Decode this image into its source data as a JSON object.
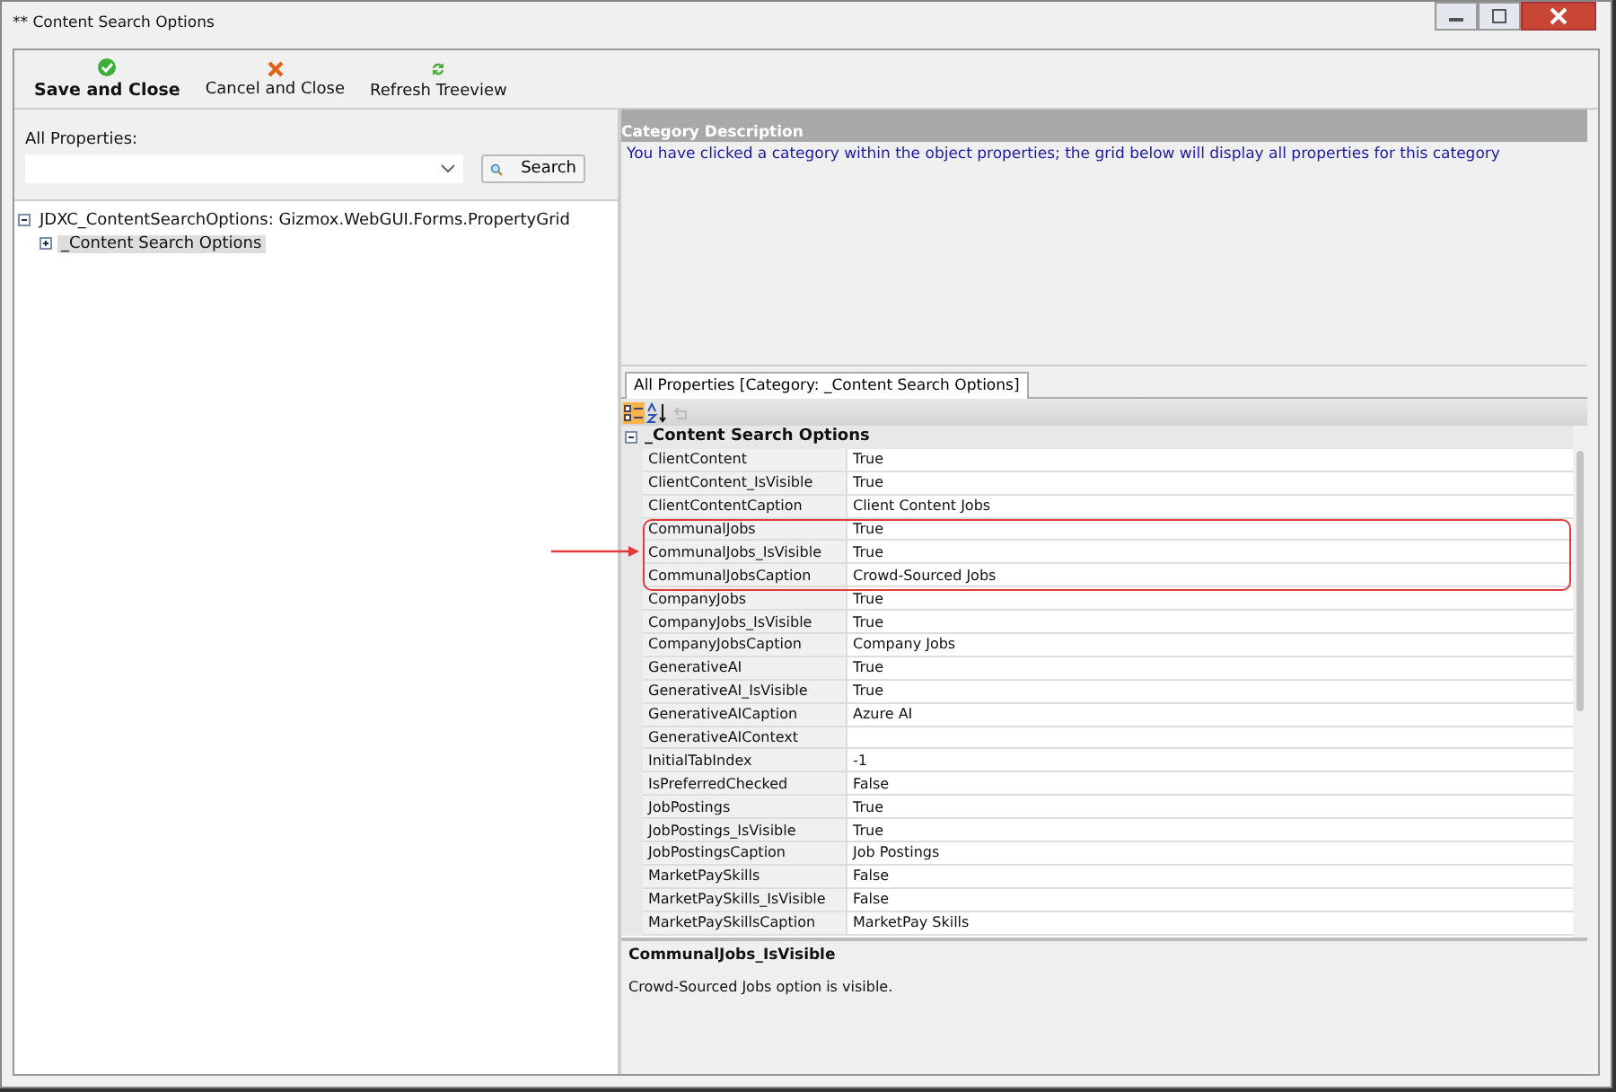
{
  "window": {
    "title": "** Content Search Options"
  },
  "toolbar": [
    {
      "label": "Save and Close",
      "kind": "save",
      "bold": true
    },
    {
      "label": "Cancel and Close",
      "kind": "cancel",
      "bold": false
    },
    {
      "label": "Refresh Treeview",
      "kind": "refresh",
      "bold": false
    }
  ],
  "search": {
    "label": "All Properties:",
    "button": "Search"
  },
  "tree": [
    {
      "label": "JDXC_ContentSearchOptions: Gizmox.WebGUI.Forms.PropertyGrid",
      "expanded": true,
      "selected": false,
      "children": [
        {
          "label": "_Content Search Options",
          "expanded": false,
          "selected": true
        }
      ]
    }
  ],
  "category_description": {
    "title": "Category Description",
    "text": "You have clicked a category within the object properties; the grid below will display all properties for this category"
  },
  "tabs": [
    {
      "label": "All Properties [Category: _Content Search Options]",
      "selected": true
    }
  ],
  "grid": {
    "category": "_Content Search Options",
    "rows": [
      {
        "name": "ClientContent",
        "value": "True",
        "highlighted": false
      },
      {
        "name": "ClientContent_IsVisible",
        "value": "True",
        "highlighted": false
      },
      {
        "name": "ClientContentCaption",
        "value": "Client Content Jobs",
        "highlighted": false
      },
      {
        "name": "CommunalJobs",
        "value": "True",
        "highlighted": true
      },
      {
        "name": "CommunalJobs_IsVisible",
        "value": "True",
        "highlighted": true
      },
      {
        "name": "CommunalJobsCaption",
        "value": "Crowd-Sourced Jobs",
        "highlighted": true
      },
      {
        "name": "CompanyJobs",
        "value": "True",
        "highlighted": false
      },
      {
        "name": "CompanyJobs_IsVisible",
        "value": "True",
        "highlighted": false
      },
      {
        "name": "CompanyJobsCaption",
        "value": "Company Jobs",
        "highlighted": false
      },
      {
        "name": "GenerativeAI",
        "value": "True",
        "highlighted": false
      },
      {
        "name": "GenerativeAI_IsVisible",
        "value": "True",
        "highlighted": false
      },
      {
        "name": "GenerativeAICaption",
        "value": "Azure AI",
        "highlighted": false
      },
      {
        "name": "GenerativeAIContext",
        "value": "",
        "highlighted": false
      },
      {
        "name": "InitialTabIndex",
        "value": "-1",
        "highlighted": false
      },
      {
        "name": "IsPreferredChecked",
        "value": "False",
        "highlighted": false
      },
      {
        "name": "JobPostings",
        "value": "True",
        "highlighted": false
      },
      {
        "name": "JobPostings_IsVisible",
        "value": "True",
        "highlighted": false
      },
      {
        "name": "JobPostingsCaption",
        "value": "Job Postings",
        "highlighted": false
      },
      {
        "name": "MarketPaySkills",
        "value": "False",
        "highlighted": false
      },
      {
        "name": "MarketPaySkills_IsVisible",
        "value": "False",
        "highlighted": false
      },
      {
        "name": "MarketPaySkillsCaption",
        "value": "MarketPay Skills",
        "highlighted": false
      }
    ]
  },
  "help": {
    "title": "CommunalJobs_IsVisible",
    "text": "Crowd-Sourced Jobs option is visible."
  }
}
